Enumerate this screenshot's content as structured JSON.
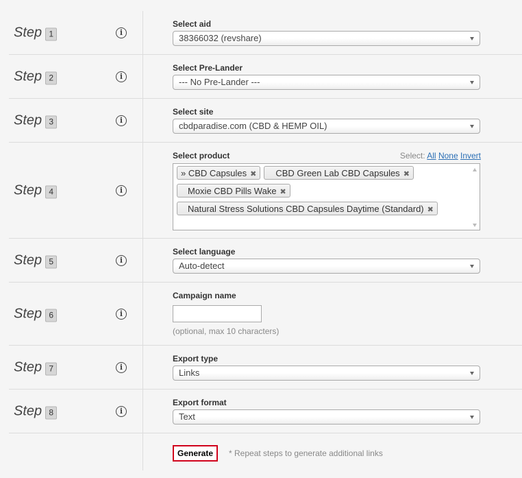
{
  "step_word": "Step",
  "info_glyph": "i",
  "steps": [
    {
      "num": "1",
      "label": "Select aid",
      "value": "38366032 (revshare)"
    },
    {
      "num": "2",
      "label": "Select Pre-Lander",
      "value": "--- No Pre-Lander ---"
    },
    {
      "num": "3",
      "label": "Select site",
      "value": "cbdparadise.com (CBD & HEMP OIL)"
    },
    {
      "num": "4",
      "label": "Select product",
      "select_prefix": "Select:",
      "select_all": "All",
      "select_none": "None",
      "select_invert": "Invert",
      "chips": [
        "» CBD Capsules",
        "CBD Green Lab CBD Capsules",
        "Moxie CBD Pills Wake",
        "Natural Stress Solutions CBD Capsules Daytime (Standard)"
      ],
      "chip_remove": "✖"
    },
    {
      "num": "5",
      "label": "Select language",
      "value": "Auto-detect"
    },
    {
      "num": "6",
      "label": "Campaign name",
      "input_value": "",
      "hint": "(optional, max 10 characters)"
    },
    {
      "num": "7",
      "label": "Export type",
      "value": "Links"
    },
    {
      "num": "8",
      "label": "Export format",
      "value": "Text"
    }
  ],
  "generate": {
    "label": "Generate",
    "hint": "* Repeat steps to generate additional links"
  },
  "colors": {
    "accent_link": "#2a6eb4",
    "generate_border": "#d0021b"
  }
}
